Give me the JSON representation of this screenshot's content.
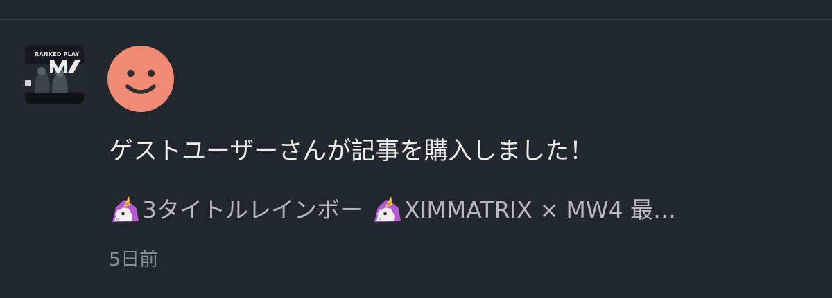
{
  "notification": {
    "message": "ゲストユーザーさんが記事を購入しました！",
    "article": {
      "thumbnail_text": "RANKED PLAY",
      "title_prefix_icon": "unicorn-emoji",
      "title_part_1": "3タイトルレインボー",
      "title_mid_icon": "unicorn-emoji",
      "title_part_2": "XIMMATRIX × MW4 最",
      "ellipsis": "…"
    },
    "timestamp": "5日前",
    "avatar_icon": "smiley-face-icon"
  },
  "colors": {
    "background": "#22272e",
    "divider": "#3b4049",
    "avatar": "#ef8a74",
    "message_text": "#ececec",
    "secondary_text": "#b6b9be",
    "timestamp_text": "#8b9097"
  }
}
